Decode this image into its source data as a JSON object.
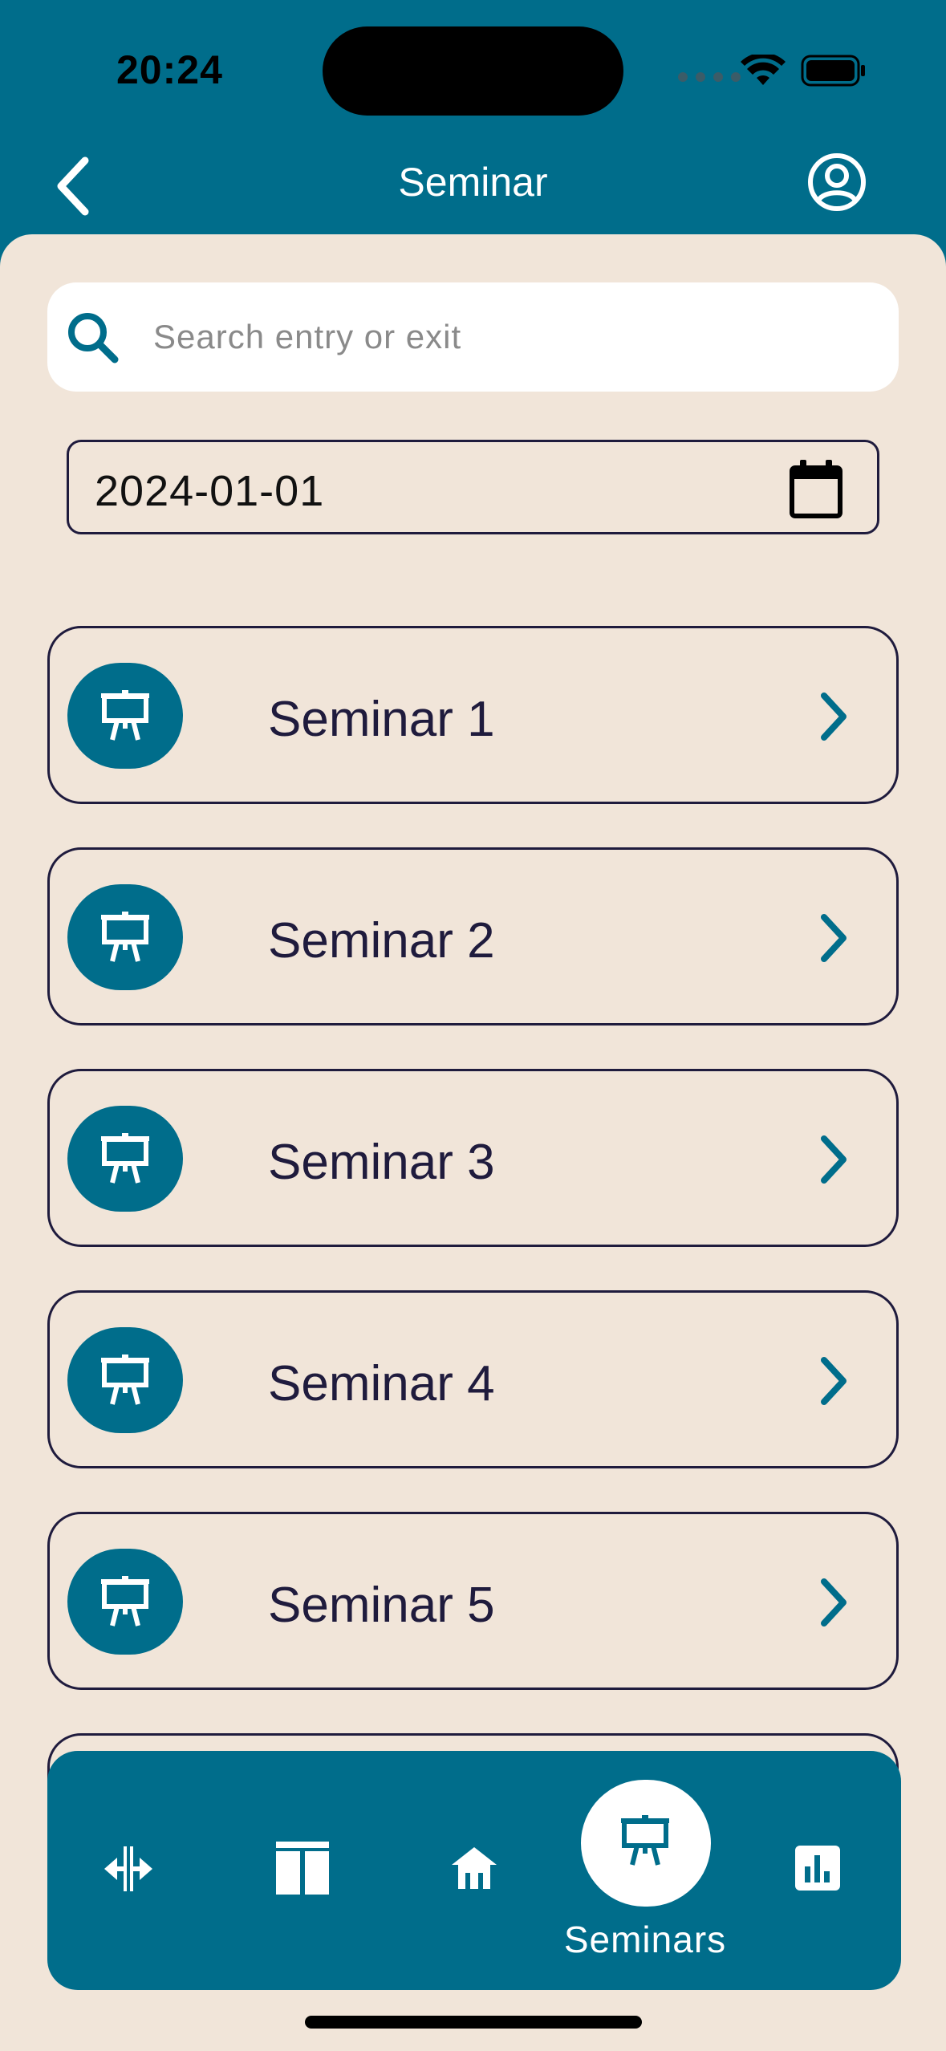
{
  "status_bar": {
    "time": "20:24"
  },
  "header": {
    "title": "Seminar"
  },
  "search": {
    "placeholder": "Search entry or exit"
  },
  "date_filter": {
    "value": "2024-01-01"
  },
  "seminars": [
    {
      "label": "Seminar 1"
    },
    {
      "label": "Seminar 2"
    },
    {
      "label": "Seminar 3"
    },
    {
      "label": "Seminar 4"
    },
    {
      "label": "Seminar 5"
    }
  ],
  "bottom_nav": {
    "items": [
      {
        "icon": "split-arrows-icon",
        "active": false
      },
      {
        "icon": "columns-icon",
        "active": false
      },
      {
        "icon": "home-icon",
        "active": false
      },
      {
        "icon": "presentation-icon",
        "active": true,
        "label": "Seminars"
      },
      {
        "icon": "bar-chart-icon",
        "active": false
      }
    ]
  },
  "colors": {
    "primary": "#006d8b",
    "background": "#f1e5d9",
    "text": "#1f1b3d",
    "surface": "#ffffff"
  }
}
